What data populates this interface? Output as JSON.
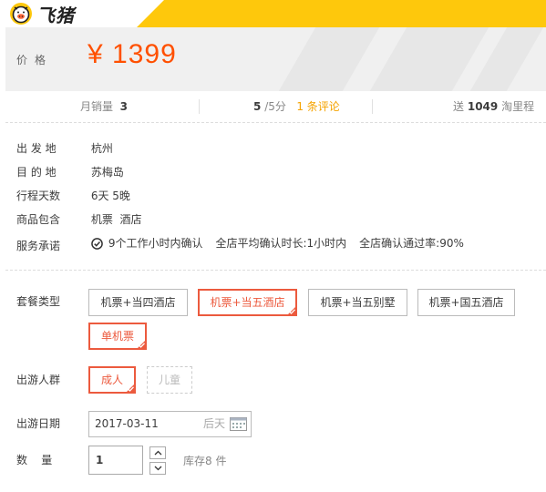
{
  "brand": {
    "logo_icon": "pig-icon",
    "name": "飞猪"
  },
  "price": {
    "label": "价格",
    "value": "¥ 1399"
  },
  "stats": {
    "monthly_sales_label": "月销量",
    "monthly_sales_value": "3",
    "rating_value": "5",
    "rating_suffix": "/5分",
    "review_link": "1 条评论",
    "mileage_prefix": "送",
    "mileage_value": "1049",
    "mileage_suffix": "淘里程"
  },
  "info": {
    "departure": {
      "label": "出 发 地",
      "value": "杭州"
    },
    "destination": {
      "label": "目 的 地",
      "value": "苏梅岛"
    },
    "duration": {
      "label": "行程天数",
      "value": "6天 5晚"
    },
    "includes": {
      "label": "商品包含",
      "value": "机票  酒店"
    },
    "service": {
      "label": "服务承诺",
      "icon": "check-circle-icon",
      "items": [
        "9个工作小时内确认",
        "全店平均确认时长:1小时内",
        "全店确认通过率:90%"
      ]
    }
  },
  "package": {
    "label": "套餐类型",
    "options": [
      {
        "label": "机票+当四酒店",
        "selected": false
      },
      {
        "label": "机票+当五酒店",
        "selected": true
      },
      {
        "label": "机票+当五别墅",
        "selected": false
      },
      {
        "label": "机票+国五酒店",
        "selected": false
      },
      {
        "label": "单机票",
        "selected": true
      }
    ]
  },
  "travelers": {
    "label": "出游人群",
    "options": [
      {
        "label": "成人",
        "selected": true
      },
      {
        "label": "儿童",
        "disabled": true
      }
    ]
  },
  "date": {
    "label": "出游日期",
    "value": "2017-03-11",
    "relative": "后天",
    "icon": "calendar-icon"
  },
  "quantity": {
    "label": "数    量",
    "value": "1",
    "stock": "库存8 件"
  },
  "colors": {
    "accent": "#ec5a3e",
    "price": "#ff5000",
    "brand_yellow": "#fec80c",
    "link": "#f5a300"
  }
}
